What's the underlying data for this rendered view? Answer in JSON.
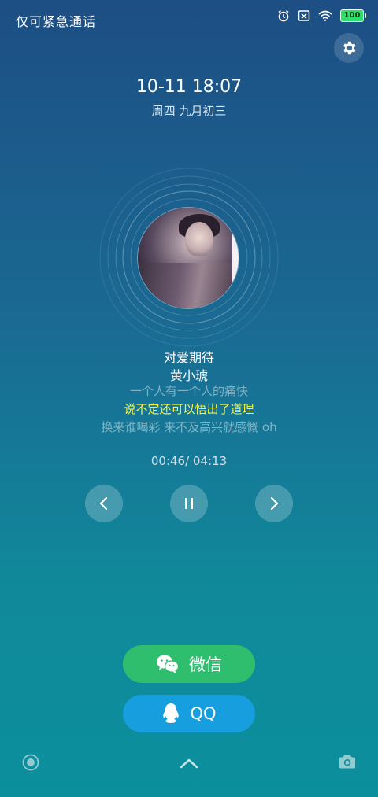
{
  "status_bar": {
    "left_text": "仅可紧急通话",
    "battery": "100"
  },
  "clock": {
    "time": "10-11  18:07",
    "date": "周四  九月初三"
  },
  "song": {
    "title": "对爱期待",
    "artist": "黄小琥",
    "lyric_prev": "一个人有一个人的痛快",
    "lyric_current": "说不定还可以悟出了道理",
    "lyric_next": "换来谁喝彩 来不及高兴就感慨 oh",
    "progress": "00:46/ 04:13"
  },
  "share": {
    "wechat_label": "微信",
    "qq_label": "QQ"
  },
  "colors": {
    "lyric_highlight": "#f3f346",
    "wechat_green": "#2fbd6e",
    "qq_blue": "#169edf",
    "battery_green": "#2ee06b"
  },
  "icons": [
    "alarm-icon",
    "no-sim-icon",
    "wifi-icon",
    "battery-icon",
    "gear-icon",
    "previous-icon",
    "pause-icon",
    "next-icon",
    "wechat-icon",
    "qq-icon",
    "record-icon",
    "chevron-up-icon",
    "camera-icon"
  ]
}
